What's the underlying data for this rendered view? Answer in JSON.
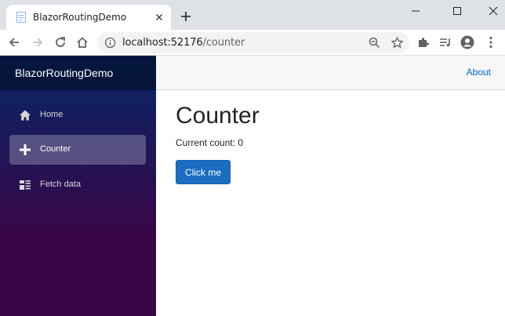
{
  "browser": {
    "tab_title": "BlazorRoutingDemo",
    "url_host": "localhost:52176",
    "url_path": "/counter",
    "icons": [
      "page-favicon",
      "close-icon",
      "plus-icon",
      "minimize-icon",
      "maximize-icon",
      "window-close-icon",
      "back-arrow-icon",
      "forward-arrow-icon",
      "reload-icon",
      "home-icon",
      "info-icon",
      "zoom-icon",
      "star-icon",
      "extensions-puzzle-icon",
      "media-queue-icon",
      "profile-avatar-icon",
      "kebab-menu-icon"
    ]
  },
  "sidebar": {
    "brand": "BlazorRoutingDemo",
    "items": [
      {
        "label": "Home",
        "icon": "home-icon",
        "active": false
      },
      {
        "label": "Counter",
        "icon": "plus-icon",
        "active": true
      },
      {
        "label": "Fetch data",
        "icon": "list-icon",
        "active": false
      }
    ]
  },
  "topbar": {
    "about_label": "About"
  },
  "main": {
    "title": "Counter",
    "count_prefix": "Current count: ",
    "count_value": "0",
    "button_label": "Click me"
  },
  "colors": {
    "sidebar_top": "#052767",
    "sidebar_bottom": "#3a0647",
    "button": "#1b6ec2",
    "link": "#0366d6"
  }
}
